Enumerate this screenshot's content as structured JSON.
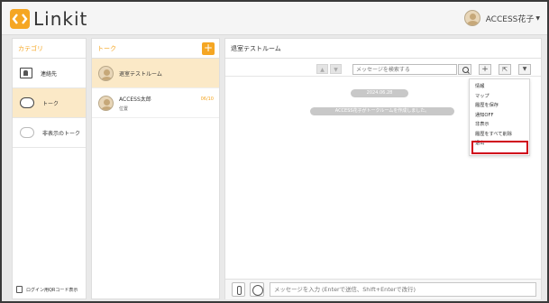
{
  "app": {
    "name": "Linkit"
  },
  "user": {
    "name": "ACCESS花子"
  },
  "categories": {
    "title": "カテゴリ",
    "items": [
      {
        "label": "連絡先",
        "icon": "contacts-book-icon"
      },
      {
        "label": "トーク",
        "icon": "speech-bubble-icon"
      },
      {
        "label": "非表示のトーク",
        "icon": "hidden-bubble-icon"
      }
    ],
    "footer": "ログイン用QRコード表示"
  },
  "talk": {
    "title": "トーク",
    "add_label": "+",
    "items": [
      {
        "name": "退室テストルーム",
        "sub": "",
        "date": ""
      },
      {
        "name": "ACCESS太郎",
        "sub": "位置",
        "date": "06/10"
      }
    ]
  },
  "room": {
    "title": "退室テストルーム",
    "search_placeholder": "メッセージを検索する",
    "date_divider": "2024.06.28",
    "system_message": "ACCESS花子がトークルームを作成しました。",
    "menu": [
      "情報",
      "マップ",
      "履歴を保存",
      "通知OFF",
      "非表示",
      "履歴をすべて削除",
      "退出"
    ],
    "message_placeholder": "メッセージを入力 (Enterで送信、Shift+Enterで改行)"
  },
  "colors": {
    "accent": "#f5a623",
    "active_row": "#fbe9c7",
    "highlight": "#d0011b"
  }
}
